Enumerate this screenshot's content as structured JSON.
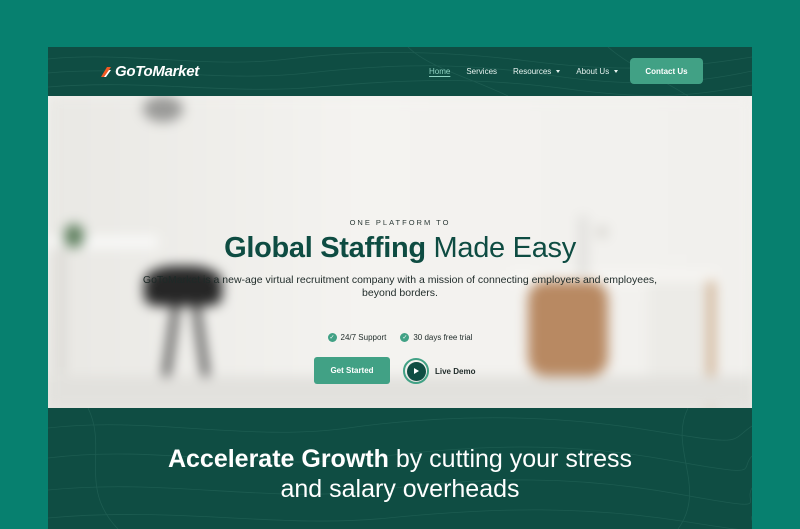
{
  "brand": {
    "name": "GoToMarket",
    "accent": "#41a185",
    "dark": "#0f4d43",
    "outer_bg": "#07806f"
  },
  "nav": {
    "items": [
      {
        "label": "Home",
        "active": true,
        "has_dropdown": false
      },
      {
        "label": "Services",
        "active": false,
        "has_dropdown": false
      },
      {
        "label": "Resources",
        "active": false,
        "has_dropdown": true
      },
      {
        "label": "About Us",
        "active": false,
        "has_dropdown": true
      }
    ],
    "contact_label": "Contact Us"
  },
  "hero": {
    "eyebrow": "ONE PLATFORM TO",
    "headline_bold": "Global Staffing",
    "headline_rest": "Made Easy",
    "subtitle": "GoToMarket is a new-age virtual recruitment company with a mission of connecting employers and employees, beyond borders.",
    "features": [
      "24/7 Support",
      "30 days free trial"
    ],
    "cta_primary": "Get Started",
    "cta_secondary": "Live Demo"
  },
  "section2": {
    "title_bold": "Accelerate Growth",
    "title_rest_line1": "by cutting your stress",
    "title_line2": "and salary overheads"
  }
}
